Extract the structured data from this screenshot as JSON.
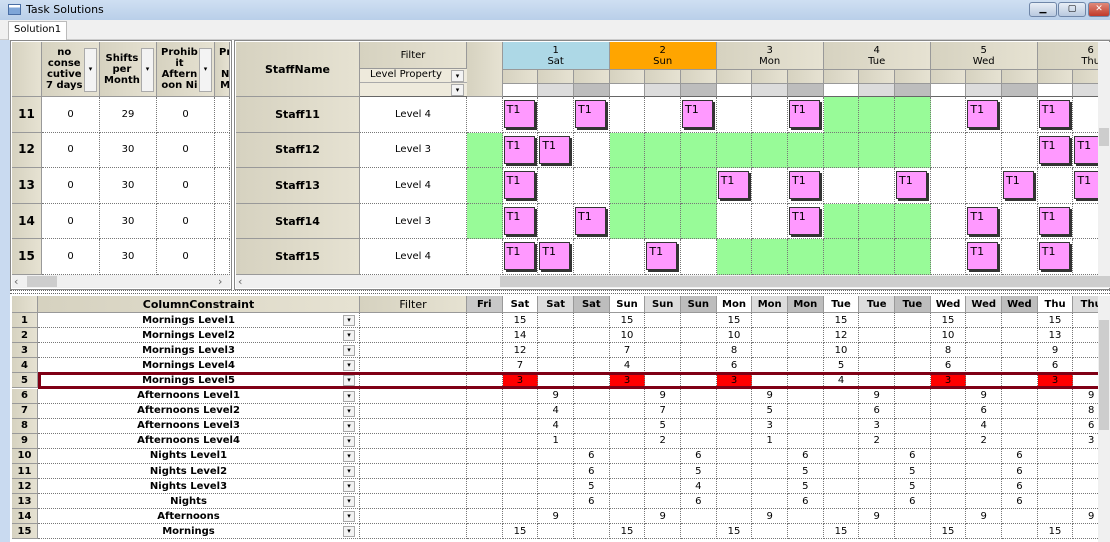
{
  "window": {
    "title": "Task Solutions",
    "controls": [
      "minimize",
      "maximize",
      "close"
    ]
  },
  "tabs": [
    {
      "label": "Solution1",
      "active": true
    }
  ],
  "colors": {
    "sat_header": "#add8e6",
    "sun_header": "#ffa500",
    "available_cell": "#98fb98",
    "task_block": "#ff99ff",
    "violation_cell": "#ff0000",
    "selected_row_border": "#800015"
  },
  "staff_props": {
    "columns": [
      "no consecutive 7 days",
      "Shifts per Month",
      "Prohibit Afternoon Ni",
      "Pr N M"
    ],
    "rows": [
      {
        "num": "11",
        "values": [
          "0",
          "29",
          "0"
        ]
      },
      {
        "num": "12",
        "values": [
          "0",
          "30",
          "0"
        ]
      },
      {
        "num": "13",
        "values": [
          "0",
          "30",
          "0"
        ]
      },
      {
        "num": "14",
        "values": [
          "0",
          "30",
          "0"
        ]
      },
      {
        "num": "15",
        "values": [
          "0",
          "30",
          "0"
        ]
      }
    ]
  },
  "schedule": {
    "staff_header": "StaffName",
    "filter_header": "Filter",
    "filter_property": "Level Property",
    "days": [
      {
        "num": "1",
        "name": "Sat"
      },
      {
        "num": "2",
        "name": "Sun"
      },
      {
        "num": "3",
        "name": "Mon"
      },
      {
        "num": "4",
        "name": "Tue"
      },
      {
        "num": "5",
        "name": "Wed"
      },
      {
        "num": "6",
        "name": "Thu"
      }
    ],
    "task_label": "T1",
    "rows": [
      {
        "name": "Staff11",
        "level": "Level 4",
        "tasks": [
          1,
          3,
          6,
          9,
          14,
          16
        ],
        "available": [
          10,
          11,
          12
        ]
      },
      {
        "name": "Staff12",
        "level": "Level 3",
        "tasks": [
          1,
          2,
          16,
          17
        ],
        "available": [
          0,
          4,
          5,
          6,
          7,
          8,
          9,
          10,
          11,
          12
        ]
      },
      {
        "name": "Staff13",
        "level": "Level 4",
        "tasks": [
          1,
          7,
          9,
          12,
          15,
          17
        ],
        "available": [
          0,
          4,
          5,
          6
        ]
      },
      {
        "name": "Staff14",
        "level": "Level 3",
        "tasks": [
          1,
          3,
          9,
          14,
          16
        ],
        "available": [
          0,
          4,
          5,
          6,
          10,
          11,
          12
        ]
      },
      {
        "name": "Staff15",
        "level": "Level 4",
        "tasks": [
          1,
          2,
          5,
          14,
          16
        ],
        "available": [
          7,
          8,
          9,
          10,
          11,
          12
        ]
      }
    ]
  },
  "constraints": {
    "header": "ColumnConstraint",
    "filter_header": "Filter",
    "columns": [
      "Fri",
      "Sat",
      "Sat",
      "Sat",
      "Sun",
      "Sun",
      "Sun",
      "Mon",
      "Mon",
      "Mon",
      "Tue",
      "Tue",
      "Tue",
      "Wed",
      "Wed",
      "Wed",
      "Thu",
      "Thu"
    ],
    "selected_row": 5,
    "rows": [
      {
        "num": "1",
        "name": "Mornings Level1",
        "values": {
          "1": "15",
          "4": "15",
          "7": "15",
          "10": "15",
          "13": "15",
          "16": "15"
        }
      },
      {
        "num": "2",
        "name": "Mornings Level2",
        "values": {
          "1": "14",
          "4": "10",
          "7": "10",
          "10": "12",
          "13": "10",
          "16": "13"
        }
      },
      {
        "num": "3",
        "name": "Mornings Level3",
        "values": {
          "1": "12",
          "4": "7",
          "7": "8",
          "10": "10",
          "13": "8",
          "16": "9"
        }
      },
      {
        "num": "4",
        "name": "Mornings Level4",
        "values": {
          "1": "7",
          "4": "4",
          "7": "6",
          "10": "5",
          "13": "6",
          "16": "6"
        }
      },
      {
        "num": "5",
        "name": "Mornings Level5",
        "values": {
          "1": "3",
          "4": "3",
          "7": "3",
          "10": "4",
          "13": "3",
          "16": "3"
        },
        "violations": [
          1,
          4,
          7,
          13,
          16
        ]
      },
      {
        "num": "6",
        "name": "Afternoons Level1",
        "values": {
          "2": "9",
          "5": "9",
          "8": "9",
          "11": "9",
          "14": "9",
          "17": "9"
        }
      },
      {
        "num": "7",
        "name": "Afternoons Level2",
        "values": {
          "2": "4",
          "5": "7",
          "8": "5",
          "11": "6",
          "14": "6",
          "17": "8"
        }
      },
      {
        "num": "8",
        "name": "Afternoons Level3",
        "values": {
          "2": "4",
          "5": "5",
          "8": "3",
          "11": "3",
          "14": "4",
          "17": "6"
        }
      },
      {
        "num": "9",
        "name": "Afternoons Level4",
        "values": {
          "2": "1",
          "5": "2",
          "8": "1",
          "11": "2",
          "14": "2",
          "17": "3"
        }
      },
      {
        "num": "10",
        "name": "Nights Level1",
        "values": {
          "3": "6",
          "6": "6",
          "9": "6",
          "12": "6",
          "15": "6"
        }
      },
      {
        "num": "11",
        "name": "Nights Level2",
        "values": {
          "3": "6",
          "6": "5",
          "9": "5",
          "12": "5",
          "15": "6"
        }
      },
      {
        "num": "12",
        "name": "Nights Level3",
        "values": {
          "3": "5",
          "6": "4",
          "9": "5",
          "12": "5",
          "15": "6"
        }
      },
      {
        "num": "13",
        "name": "Nights",
        "values": {
          "3": "6",
          "6": "6",
          "9": "6",
          "12": "6",
          "15": "6"
        }
      },
      {
        "num": "14",
        "name": "Afternoons",
        "values": {
          "2": "9",
          "5": "9",
          "8": "9",
          "11": "9",
          "14": "9",
          "17": "9"
        }
      },
      {
        "num": "15",
        "name": "Mornings",
        "values": {
          "1": "15",
          "4": "15",
          "7": "15",
          "10": "15",
          "13": "15",
          "16": "15"
        }
      }
    ]
  }
}
